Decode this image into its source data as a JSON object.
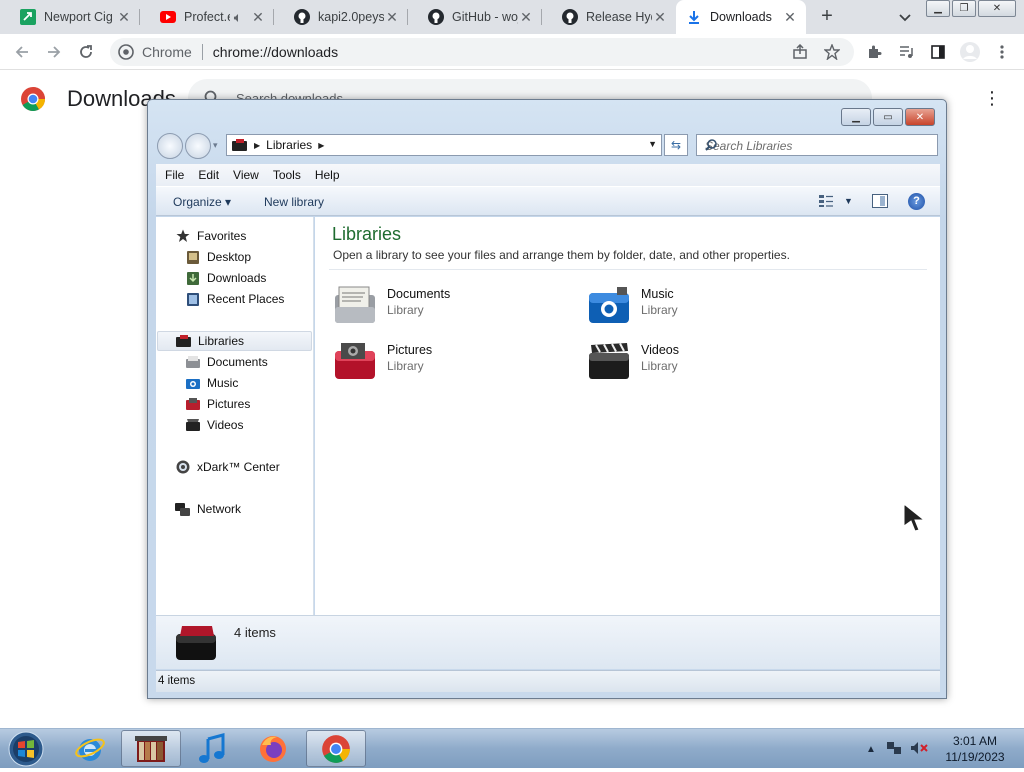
{
  "browser": {
    "tabs": [
      {
        "title": "Newport Cig",
        "icon": "newport-favicon",
        "color": "#1aa260"
      },
      {
        "title": "Profect.e",
        "icon": "youtube-favicon",
        "color": "#ff0000"
      },
      {
        "title": "kapi2.0peys",
        "icon": "github-favicon"
      },
      {
        "title": "GitHub - woj",
        "icon": "github-favicon"
      },
      {
        "title": "Release Hyd",
        "icon": "github-favicon"
      },
      {
        "title": "Downloads",
        "icon": "download-favicon",
        "active": true,
        "color": "#1a73e8"
      }
    ],
    "site_label": "Chrome",
    "url": "chrome://downloads"
  },
  "downloads_page": {
    "title": "Downloads",
    "search_placeholder": "Search downloads"
  },
  "explorer": {
    "address": "Libraries",
    "search_placeholder": "Search Libraries",
    "menu": [
      "File",
      "Edit",
      "View",
      "Tools",
      "Help"
    ],
    "commands": {
      "organize": "Organize",
      "new_library": "New library"
    },
    "nav": {
      "favorites": {
        "label": "Favorites",
        "items": [
          "Desktop",
          "Downloads",
          "Recent Places"
        ]
      },
      "libraries": {
        "label": "Libraries",
        "items": [
          "Documents",
          "Music",
          "Pictures",
          "Videos"
        ]
      },
      "center": "xDark™ Center",
      "network": "Network"
    },
    "content": {
      "title": "Libraries",
      "description": "Open a library to see your files and arrange them by folder, date, and other properties.",
      "items": [
        {
          "name": "Documents",
          "type": "Library",
          "icon": "documents-library-icon"
        },
        {
          "name": "Music",
          "type": "Library",
          "icon": "music-library-icon"
        },
        {
          "name": "Pictures",
          "type": "Library",
          "icon": "pictures-library-icon"
        },
        {
          "name": "Videos",
          "type": "Library",
          "icon": "videos-library-icon"
        }
      ]
    },
    "details_count": "4 items",
    "status_count": "4 items"
  },
  "taskbar": {
    "apps": [
      "internet-explorer",
      "library-explorer",
      "itunes",
      "firefox",
      "chrome"
    ],
    "time": "3:01 AM",
    "date": "11/19/2023"
  }
}
